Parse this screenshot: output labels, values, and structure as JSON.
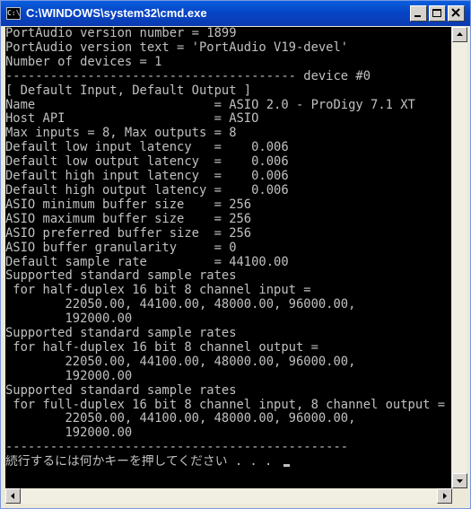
{
  "window": {
    "title": "C:\\WINDOWS\\system32\\cmd.exe",
    "icon_text": "C:\\"
  },
  "console": {
    "lines": [
      "PortAudio version number = 1899",
      "PortAudio version text = 'PortAudio V19-devel'",
      "Number of devices = 1",
      "--------------------------------------- device #0",
      "[ Default Input, Default Output ]",
      "Name                        = ASIO 2.0 - ProDigy 7.1 XT",
      "Host API                    = ASIO",
      "Max inputs = 8, Max outputs = 8",
      "Default low input latency   =    0.006",
      "Default low output latency  =    0.006",
      "Default high input latency  =    0.006",
      "Default high output latency =    0.006",
      "ASIO minimum buffer size    = 256",
      "ASIO maximum buffer size    = 256",
      "ASIO preferred buffer size  = 256",
      "ASIO buffer granularity     = 0",
      "Default sample rate         = 44100.00",
      "Supported standard sample rates",
      " for half-duplex 16 bit 8 channel input = ",
      "        22050.00, 44100.00, 48000.00, 96000.00,",
      "        192000.00",
      "Supported standard sample rates",
      " for half-duplex 16 bit 8 channel output = ",
      "        22050.00, 44100.00, 48000.00, 96000.00,",
      "        192000.00",
      "Supported standard sample rates",
      " for full-duplex 16 bit 8 channel input, 8 channel output = ",
      "        22050.00, 44100.00, 48000.00, 96000.00,",
      "        192000.00",
      "----------------------------------------------",
      "続行するには何かキーを押してください . . . "
    ]
  },
  "icons": {
    "minimize": "minimize-icon",
    "maximize": "maximize-icon",
    "close": "close-icon",
    "scroll_up": "arrow-up-icon",
    "scroll_down": "arrow-down-icon",
    "scroll_left": "arrow-left-icon",
    "scroll_right": "arrow-right-icon"
  },
  "colors": {
    "console_background": "#000000",
    "console_text": "#c0c0c0",
    "titlebar": "#0a5fde"
  }
}
